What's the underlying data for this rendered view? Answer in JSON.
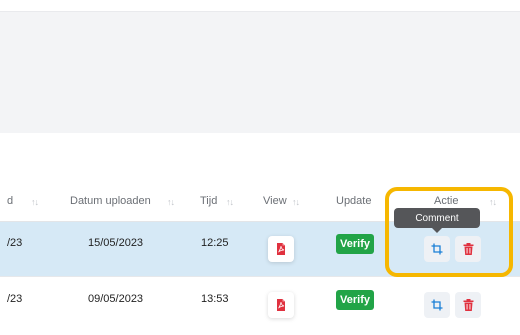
{
  "table": {
    "columns": [
      {
        "label": "d",
        "sort_icon": "sort-arrows-icon"
      },
      {
        "label": "Datum uploaden",
        "sort_icon": "sort-arrows-icon"
      },
      {
        "label": "Tijd",
        "sort_icon": "sort-arrows-icon"
      },
      {
        "label": "View",
        "sort_icon": "sort-arrows-icon"
      },
      {
        "label": "Update"
      },
      {
        "label": "Actie",
        "sort_icon": "sort-arrows-icon"
      }
    ],
    "sort_glyph": "↑↓",
    "rows": [
      {
        "date_partial": "/23",
        "upload_date": "15/05/2023",
        "time": "12:25",
        "verify_label": "Verify",
        "highlighted": true
      },
      {
        "date_partial": "/23",
        "upload_date": "09/05/2023",
        "time": "13:53",
        "verify_label": "Verify",
        "highlighted": false
      }
    ]
  },
  "tooltip": {
    "text": "Comment"
  },
  "colors": {
    "verify_green": "#22a447",
    "pdf_red": "#e0313f",
    "action_blue": "#1a7fd6",
    "delete_red": "#e0313f",
    "row_highlight": "#d6e9f6",
    "annotation_outline": "#f6b700"
  },
  "icons": {
    "view": "pdf-file-icon",
    "comment": "crop-comment-icon",
    "delete": "trash-icon"
  }
}
